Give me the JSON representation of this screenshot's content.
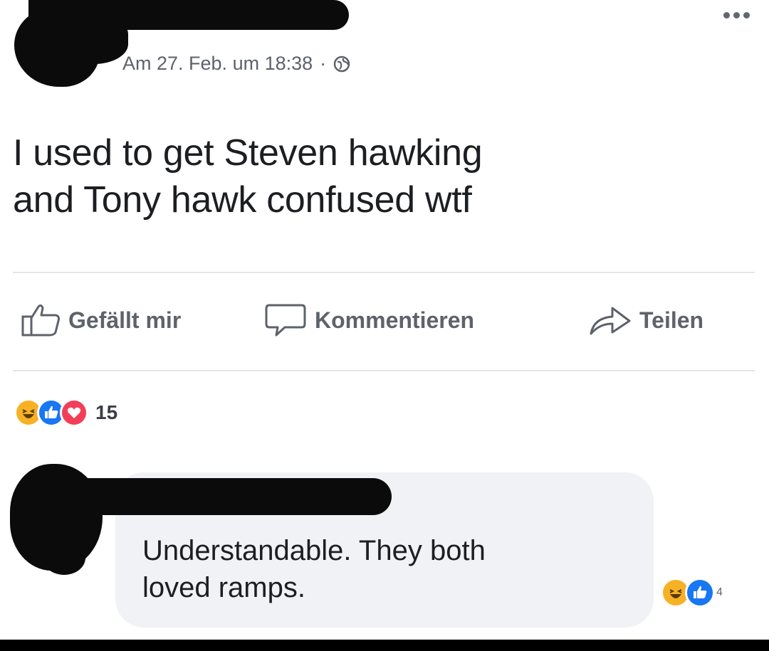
{
  "post": {
    "timestamp": "Am 27. Feb. um 18:38",
    "separator": "·",
    "privacy_icon": "globe-icon",
    "more_icon": "more-options-icon",
    "text_line1": "I used to get Steven hawking",
    "text_line2": "and Tony hawk confused wtf"
  },
  "actions": {
    "like_label": "Gefällt mir",
    "comment_label": "Kommentieren",
    "share_label": "Teilen"
  },
  "reactions": {
    "icons": [
      "haha-icon",
      "like-icon",
      "love-icon"
    ],
    "count": "15"
  },
  "comment": {
    "text_line1": "Understandable. They both",
    "text_line2": "loved ramps.",
    "reaction_icons": [
      "haha-icon",
      "like-icon"
    ],
    "reaction_count": "4"
  },
  "colors": {
    "like_blue": "#1877f2",
    "love_red": "#f33e58",
    "haha_yellow": "#f7b125",
    "secondary_text": "#5d626b",
    "bubble_bg": "#f0f2f5"
  }
}
